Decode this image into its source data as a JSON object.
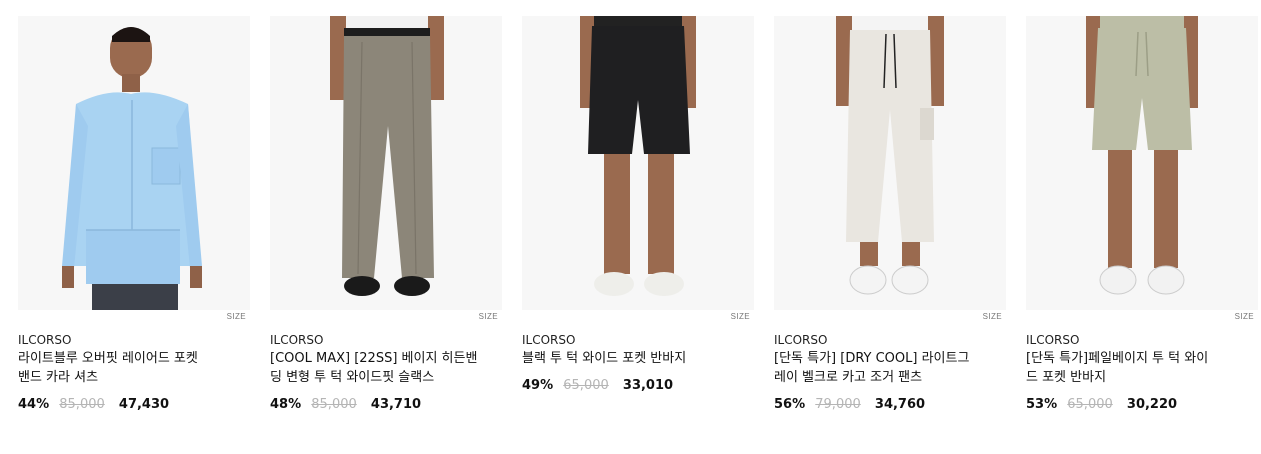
{
  "products": [
    {
      "brand": "ILCORSO",
      "title_line1": "라이트블루 오버핏 레이어드 포켓",
      "title_line2": "밴드 카라 셔츠",
      "discount": "44%",
      "original_price": "85,000",
      "sale_price": "47,430",
      "size_label": "SIZE",
      "garment_color": "#a9d3f2"
    },
    {
      "brand": "ILCORSO",
      "title_line1": "[COOL MAX] [22SS] 베이지 히든밴",
      "title_line2": "딩 변형 투 턱 와이드핏 슬랙스",
      "discount": "48%",
      "original_price": "85,000",
      "sale_price": "43,710",
      "size_label": "SIZE",
      "garment_color": "#8c8679"
    },
    {
      "brand": "ILCORSO",
      "title_line1": "블랙 투 턱 와이드 포켓 반바지",
      "title_line2": "",
      "discount": "49%",
      "original_price": "65,000",
      "sale_price": "33,010",
      "size_label": "SIZE",
      "garment_color": "#1f1f21"
    },
    {
      "brand": "ILCORSO",
      "title_line1": "[단독 특가] [DRY COOL] 라이트그",
      "title_line2": "레이 벨크로 카고 조거 팬츠",
      "discount": "56%",
      "original_price": "79,000",
      "sale_price": "34,760",
      "size_label": "SIZE",
      "garment_color": "#e9e6e0"
    },
    {
      "brand": "ILCORSO",
      "title_line1": "[단독 특가]페일베이지 투 턱 와이",
      "title_line2": "드 포켓 반바지",
      "discount": "53%",
      "original_price": "65,000",
      "sale_price": "30,220",
      "size_label": "SIZE",
      "garment_color": "#bcbea6"
    }
  ]
}
